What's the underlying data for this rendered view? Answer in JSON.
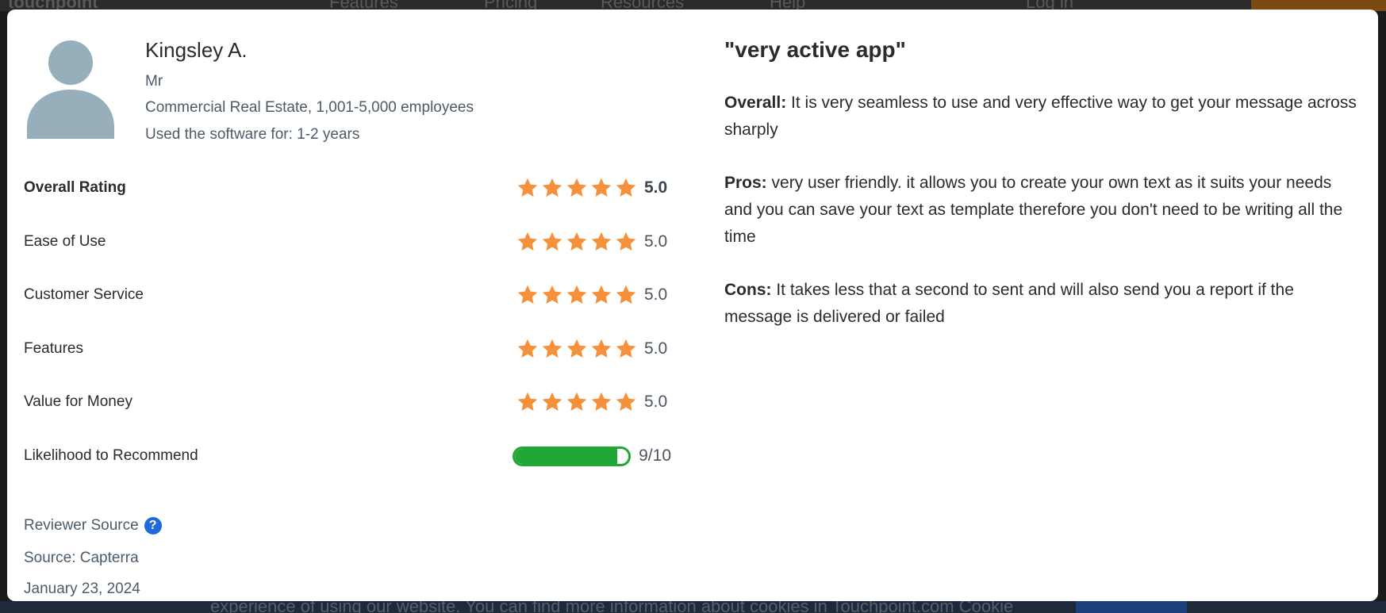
{
  "background": {
    "logo": "touchpoint",
    "nav": [
      "Features",
      "Pricing",
      "Resources",
      "Help",
      "Log in"
    ],
    "cookie_text": "experience of using our website. You can find more information about cookies in Touchpoint.com Cookie"
  },
  "reviewer": {
    "name": "Kingsley A.",
    "title": "Mr",
    "industry": "Commercial Real Estate",
    "separator": ", ",
    "company_size": "1,001-5,000 employees",
    "used_for": "Used the software for: 1-2 years",
    "avatar_icon": "user-avatar-icon"
  },
  "ratings": [
    {
      "label": "Overall Rating",
      "value": "5.0",
      "stars": 5
    },
    {
      "label": "Ease of Use",
      "value": "5.0",
      "stars": 5
    },
    {
      "label": "Customer Service",
      "value": "5.0",
      "stars": 5
    },
    {
      "label": "Features",
      "value": "5.0",
      "stars": 5
    },
    {
      "label": "Value for Money",
      "value": "5.0",
      "stars": 5
    }
  ],
  "recommend": {
    "label": "Likelihood to Recommend",
    "value_text": "9/10",
    "fraction": 0.9
  },
  "source": {
    "label": "Reviewer Source",
    "help_icon": "question-icon",
    "help_glyph": "?",
    "text": "Source: Capterra",
    "date": "January 23, 2024"
  },
  "review": {
    "title": "\"very active app\"",
    "overall_label": "Overall:",
    "overall_text": " It is very seamless to use and very effective way to get your message across sharply",
    "pros_label": "Pros:",
    "pros_text": " very user friendly. it allows you to create your own text as it suits your needs and you can save your text as template therefore you don't need to be writing all the time",
    "cons_label": "Cons:",
    "cons_text": " It takes less that a second to sent and will also send you a report if the message is delivered or failed"
  },
  "colors": {
    "star": "#f7903a",
    "recommend": "#22a636",
    "avatar": "#97aebb",
    "help": "#1f6ad8"
  }
}
